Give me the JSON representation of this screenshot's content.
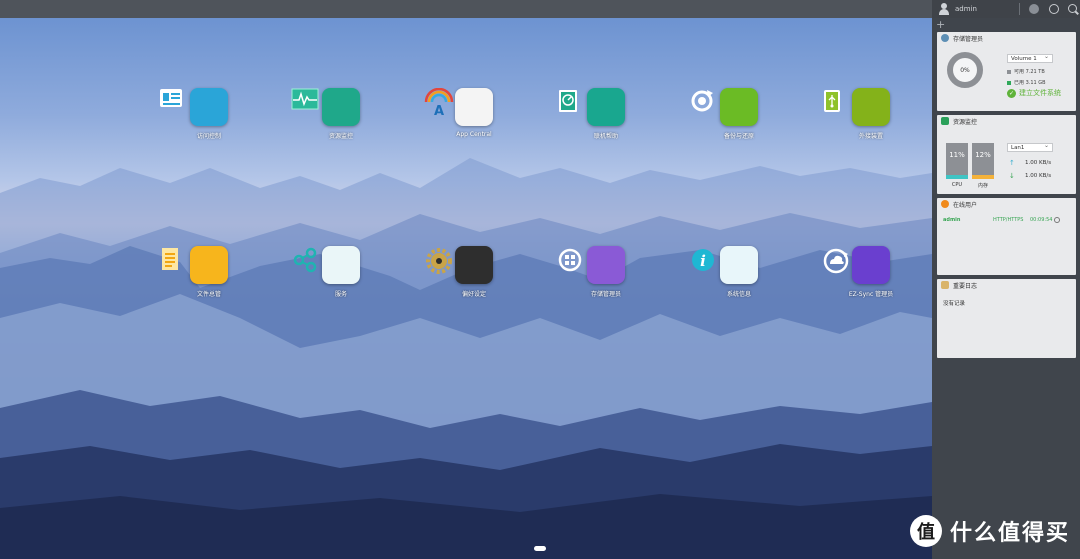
{
  "topbar": {
    "username": "admin"
  },
  "apps": [
    {
      "label": "访问控制",
      "icon": "access-control-icon",
      "color": "#2aa5d8"
    },
    {
      "label": "资源监控",
      "icon": "resource-monitor-icon",
      "color": "#1fa88a"
    },
    {
      "label": "App Central",
      "icon": "app-central-icon",
      "color": "#f4f4f4"
    },
    {
      "label": "联机帮助",
      "icon": "online-help-icon",
      "color": "#19a78f"
    },
    {
      "label": "备份与还原",
      "icon": "backup-restore-icon",
      "color": "#6bbb25"
    },
    {
      "label": "外接装置",
      "icon": "external-devices-icon",
      "color": "#84b21a"
    },
    {
      "label": "文件总管",
      "icon": "file-explorer-icon",
      "color": "#f7b51c"
    },
    {
      "label": "服务",
      "icon": "services-icon",
      "color": "#eaf6f8"
    },
    {
      "label": "偏好设定",
      "icon": "preferences-icon",
      "color": "#2e2e2e"
    },
    {
      "label": "存储管理员",
      "icon": "storage-manager-icon",
      "color": "#8a5ad6"
    },
    {
      "label": "系统信息",
      "icon": "system-info-icon",
      "color": "#e8f6fa"
    },
    {
      "label": "EZ-Sync 管理员",
      "icon": "ez-sync-icon",
      "color": "#6a3fcf"
    }
  ],
  "widgets": {
    "storage": {
      "title": "存储管理员",
      "usage": "0%",
      "volume": "Volume 1",
      "available": "可用 7.21 TB",
      "used": "已用 3.11 GB",
      "available_color": "#8d9095",
      "used_color": "#2fa85a",
      "create_label": "建立文件系统"
    },
    "resource": {
      "title": "资源监控",
      "cpu_pct": "11%",
      "cpu_label": "CPU",
      "mem_pct": "12%",
      "mem_label": "内存",
      "cpu_value": 11,
      "mem_value": 12,
      "lan": "Lan1",
      "upload": "1.00 KB/s",
      "download": "1.00 KB/s"
    },
    "online": {
      "title": "在线用户",
      "user": "admin",
      "protocol": "HTTP/HTTPS",
      "time": "00:09:54"
    },
    "log": {
      "title": "重要日志",
      "empty": "没有记录"
    }
  },
  "watermark": {
    "badge": "值",
    "text": "什么值得买"
  }
}
